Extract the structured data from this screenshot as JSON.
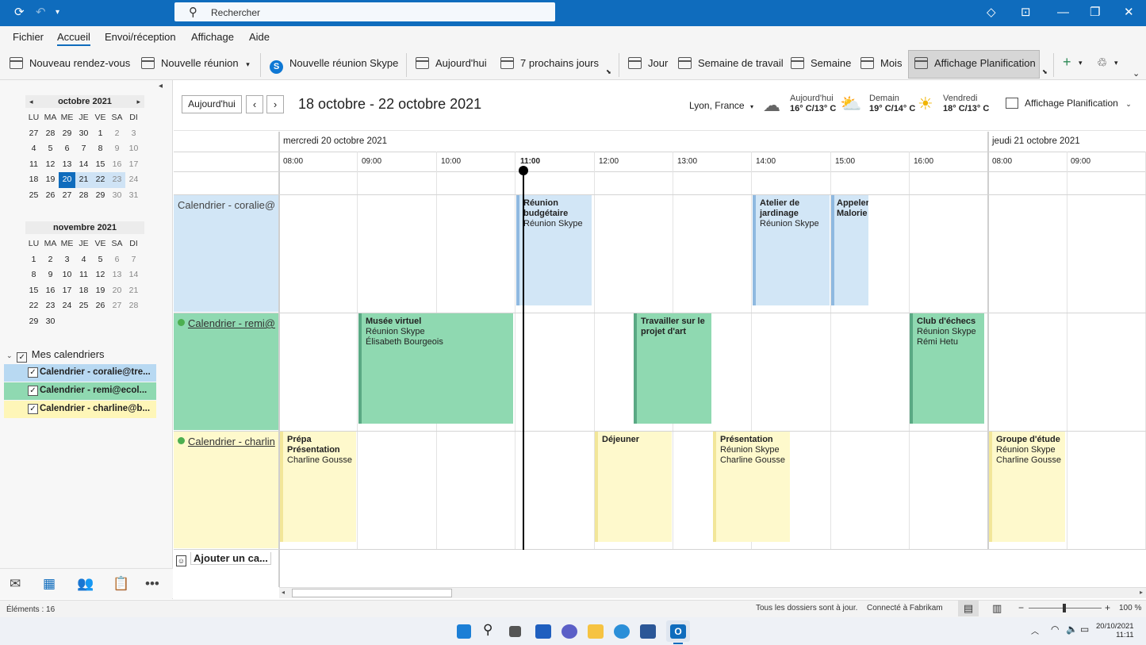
{
  "titlebar": {
    "search_placeholder": "Rechercher"
  },
  "menu": [
    "Fichier",
    "Accueil",
    "Envoi/réception",
    "Affichage",
    "Aide"
  ],
  "ribbon": {
    "new_appointment": "Nouveau rendez-vous",
    "new_meeting": "Nouvelle réunion",
    "new_skype": "Nouvelle réunion Skype",
    "today": "Aujourd'hui",
    "next7": "7 prochains jours",
    "day": "Jour",
    "work_week": "Semaine de travail",
    "week": "Semaine",
    "month": "Mois",
    "schedule_view": "Affichage Planification"
  },
  "minical_oct": {
    "title": "octobre 2021",
    "headers": [
      "LU",
      "MA",
      "ME",
      "JE",
      "VE",
      "SA",
      "DI"
    ],
    "rows": [
      [
        "27",
        "28",
        "29",
        "30",
        "1",
        "2",
        "3"
      ],
      [
        "4",
        "5",
        "6",
        "7",
        "8",
        "9",
        "10"
      ],
      [
        "11",
        "12",
        "13",
        "14",
        "15",
        "16",
        "17"
      ],
      [
        "18",
        "19",
        "20",
        "21",
        "22",
        "23",
        "24"
      ],
      [
        "25",
        "26",
        "27",
        "28",
        "29",
        "30",
        "31"
      ]
    ]
  },
  "minical_nov": {
    "title": "novembre 2021",
    "headers": [
      "LU",
      "MA",
      "ME",
      "JE",
      "VE",
      "SA",
      "DI"
    ],
    "rows": [
      [
        "1",
        "2",
        "3",
        "4",
        "5",
        "6",
        "7"
      ],
      [
        "8",
        "9",
        "10",
        "11",
        "12",
        "13",
        "14"
      ],
      [
        "15",
        "16",
        "17",
        "18",
        "19",
        "20",
        "21"
      ],
      [
        "22",
        "23",
        "24",
        "25",
        "26",
        "27",
        "28"
      ],
      [
        "29",
        "30",
        "",
        "",
        "",
        "",
        ""
      ]
    ]
  },
  "calendars": {
    "group": "Mes calendriers",
    "items": [
      "Calendrier - coralie@tre...",
      "Calendrier - remi@ecol...",
      "Calendrier - charline@b..."
    ]
  },
  "toolbar": {
    "today": "Aujourd'hui",
    "range": "18 octobre - 22 octobre 2021",
    "location": "Lyon, France",
    "weather": [
      {
        "day": "Aujourd'hui",
        "temp": "16° C/13° C"
      },
      {
        "day": "Demain",
        "temp": "19° C/14° C"
      },
      {
        "day": "Vendredi",
        "temp": "18° C/13° C"
      }
    ],
    "view": "Affichage Planification"
  },
  "schedule": {
    "day1": "mercredi 20 octobre 2021",
    "day2": "jeudi 21 octobre 2021",
    "hours": [
      "08:00",
      "09:00",
      "10:00",
      "11:00",
      "12:00",
      "13:00",
      "14:00",
      "15:00",
      "16:00",
      "08:00",
      "09:00"
    ],
    "rows": [
      "Calendrier - coralie@",
      "Calendrier - remi@",
      "Calendrier - charlin"
    ],
    "add_calendar": "Ajouter un ca...",
    "events": [
      {
        "title": "Réunion budgétaire",
        "l2": "Réunion Skype",
        "l3": ""
      },
      {
        "title": "Atelier de jardinage",
        "l2": "Réunion Skype",
        "l3": ""
      },
      {
        "title": "Appeler Malorie",
        "l2": "",
        "l3": ""
      },
      {
        "title": "Musée virtuel",
        "l2": "Réunion Skype",
        "l3": "Élisabeth Bourgeois"
      },
      {
        "title": "Travailler sur le projet d'art",
        "l2": "",
        "l3": ""
      },
      {
        "title": "Club d'échecs",
        "l2": "Réunion Skype",
        "l3": "Rémi Hetu"
      },
      {
        "title": "Prépa Présentation",
        "l2": "Charline Gousse",
        "l3": ""
      },
      {
        "title": "Déjeuner",
        "l2": "",
        "l3": ""
      },
      {
        "title": "Présentation",
        "l2": "Réunion Skype",
        "l3": "Charline Gousse"
      },
      {
        "title": "Groupe d'étude",
        "l2": "Réunion Skype",
        "l3": "Charline Gousse"
      }
    ]
  },
  "status": {
    "items": "Éléments : 16",
    "sync": "Tous les dossiers sont à jour.",
    "connected": "Connecté à Fabrikam",
    "zoom": "100 %"
  },
  "taskbar": {
    "date": "20/10/2021",
    "time": "11:11"
  }
}
